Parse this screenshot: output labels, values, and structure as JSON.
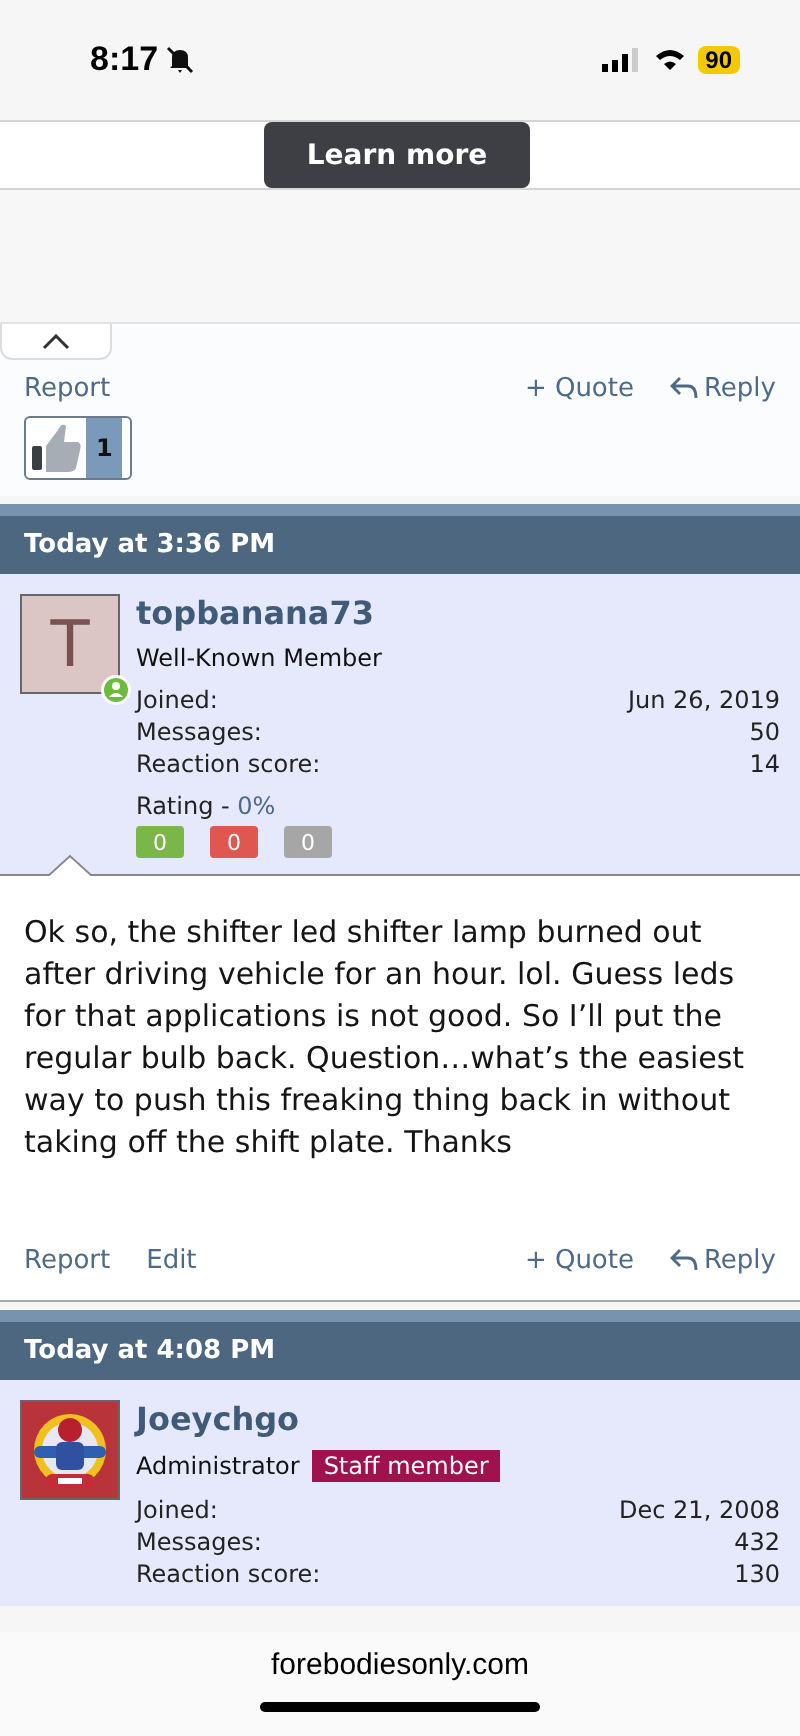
{
  "status_bar": {
    "time": "8:17",
    "battery": "90"
  },
  "ad": {
    "button": "Learn more"
  },
  "previous_post": {
    "actions_left": [
      "Report"
    ],
    "quote": "+ Quote",
    "reply": "Reply",
    "reaction_count": "1"
  },
  "posts": [
    {
      "time": "Today at 3:36 PM",
      "avatar": {
        "kind": "letter",
        "letter": "T"
      },
      "online": true,
      "username": "topbanana73",
      "title": "Well-Known Member",
      "stats": [
        {
          "label": "Joined:",
          "value": "Jun 26, 2019"
        },
        {
          "label": "Messages:",
          "value": "50"
        },
        {
          "label": "Reaction score:",
          "value": "14"
        }
      ],
      "rating": {
        "label": "Rating - ",
        "value": "0%",
        "counts": [
          {
            "value": "0",
            "color": "#7ab648"
          },
          {
            "value": "0",
            "color": "#e0574f"
          },
          {
            "value": "0",
            "color": "#a6a6a6"
          }
        ]
      },
      "body": "Ok so, the shifter led shifter lamp burned out after driving vehicle for an hour. lol. Guess leds for that applications is not good. So I’ll put the regular bulb back. Question…what’s the easiest way to push this freaking thing back in without taking off the shift plate. Thanks",
      "actions_left": [
        "Report",
        "Edit"
      ],
      "quote": "+ Quote",
      "reply": "Reply"
    },
    {
      "time": "Today at 4:08 PM",
      "online": false,
      "username": "Joeychgo",
      "title": "Administrator",
      "badge": "Staff member",
      "stats": [
        {
          "label": "Joined:",
          "value": "Dec 21, 2008"
        },
        {
          "label": "Messages:",
          "value": "432"
        },
        {
          "label": "Reaction score:",
          "value": "130"
        }
      ]
    }
  ],
  "address_bar": {
    "url": "forebodiesonly.com"
  }
}
